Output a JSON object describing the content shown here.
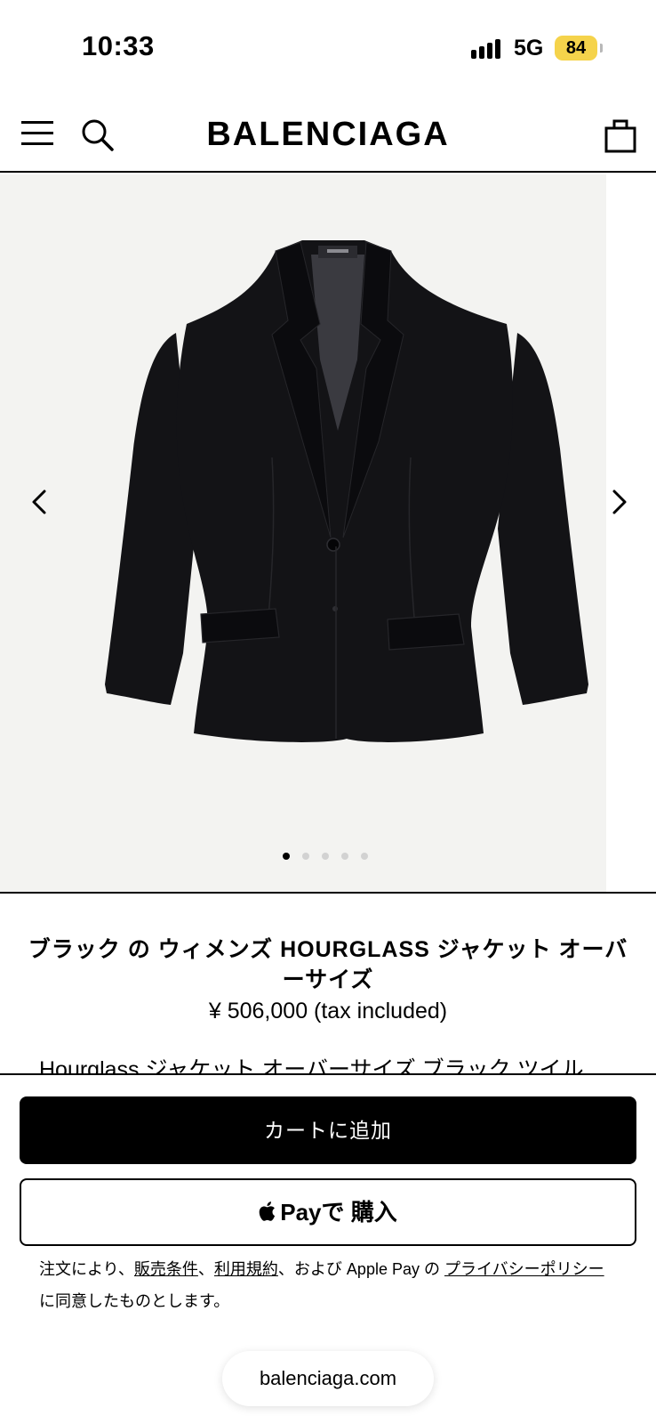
{
  "status_bar": {
    "time": "10:33",
    "network": "5G",
    "battery": "84"
  },
  "header": {
    "brand": "BALENCIAGA"
  },
  "gallery": {
    "image_count": 5,
    "active_index": 0
  },
  "product": {
    "title": "ブラック の ウィメンズ HOURGLASS ジャケット オーバーサイズ",
    "price": "¥ 506,000 (tax included)",
    "description": "Hourglass ジャケット オーバーサイズ ブラック ツイル"
  },
  "actions": {
    "add_to_cart": "カートに追加",
    "apple_pay_label": "Pay",
    "apple_pay_suffix": "で 購入"
  },
  "legal": {
    "prefix": "注文により、",
    "link_sales": "販売条件",
    "sep": "、",
    "link_terms": "利用規約",
    "middle": "、および Apple Pay の ",
    "link_privacy": "プライバシーポリシー",
    "suffix": " に同意したものとします。"
  },
  "browser": {
    "url": "balenciaga.com"
  },
  "colors": {
    "battery": "#f5d34b",
    "image_bg": "#f3f3f1",
    "jacket": "#131316"
  }
}
